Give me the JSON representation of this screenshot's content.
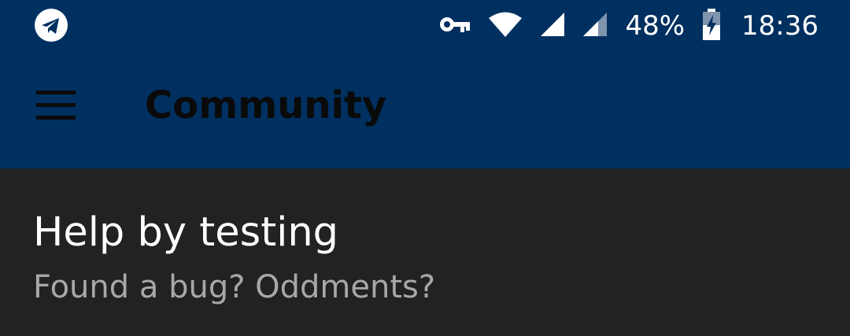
{
  "status_bar": {
    "left_icon": "telegram-icon",
    "icons": [
      "vpn-key-icon",
      "wifi-icon",
      "signal-icon",
      "signal-weak-icon",
      "battery-charging-icon"
    ],
    "battery_percent": "48%",
    "time": "18:36"
  },
  "app_bar": {
    "menu_icon": "hamburger-menu-icon",
    "title": "Community"
  },
  "items": [
    {
      "title": "Help by testing",
      "subtitle": "Found a bug? Oddments?"
    }
  ],
  "colors": {
    "status_bar_bg": "#003060",
    "app_bar_bg": "#003060",
    "content_bg": "#222222",
    "title_text": "#0a0a0a",
    "primary_text": "#ffffff",
    "secondary_text": "#a8a8a8"
  }
}
